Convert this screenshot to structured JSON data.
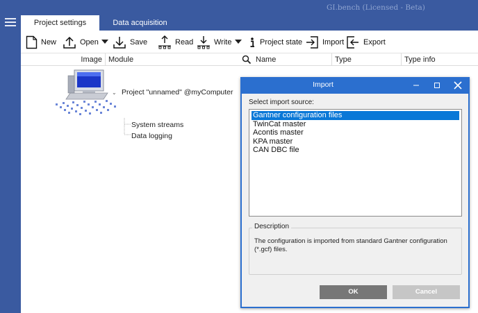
{
  "app": {
    "title": "GI.bench (Licensed - Beta)"
  },
  "side": {
    "menu_icon": "hamburger-menu-icon"
  },
  "tabs": [
    {
      "label": "Project settings",
      "active": true
    },
    {
      "label": "Data acquisition",
      "active": false
    }
  ],
  "toolbar": {
    "new_label": "New",
    "open_label": "Open",
    "save_label": "Save",
    "read_label": "Read",
    "write_label": "Write",
    "project_state_label": "Project state",
    "import_label": "Import",
    "export_label": "Export"
  },
  "columns": {
    "image": "Image",
    "module": "Module",
    "name": "Name",
    "type": "Type",
    "type_info": "Type info"
  },
  "tree": {
    "project": "Project \"unnamed\" @myComputer",
    "children": [
      "System streams",
      "Data logging"
    ]
  },
  "dialog": {
    "title": "Import",
    "source_label": "Select import source:",
    "sources": [
      "Gantner configuration files",
      "TwinCat master",
      "Acontis master",
      "KPA master",
      "CAN DBC file"
    ],
    "selected_index": 0,
    "description_label": "Description",
    "description_text": "The configuration is imported from standard Gantner configuration (*.gcf) files.",
    "ok_label": "OK",
    "cancel_label": "Cancel"
  },
  "colors": {
    "frame": "#3a5aa0",
    "dialog_border": "#2b6fcf",
    "selection": "#0a78d7",
    "ok_button": "#777777",
    "cancel_button": "#c6c6c6"
  }
}
